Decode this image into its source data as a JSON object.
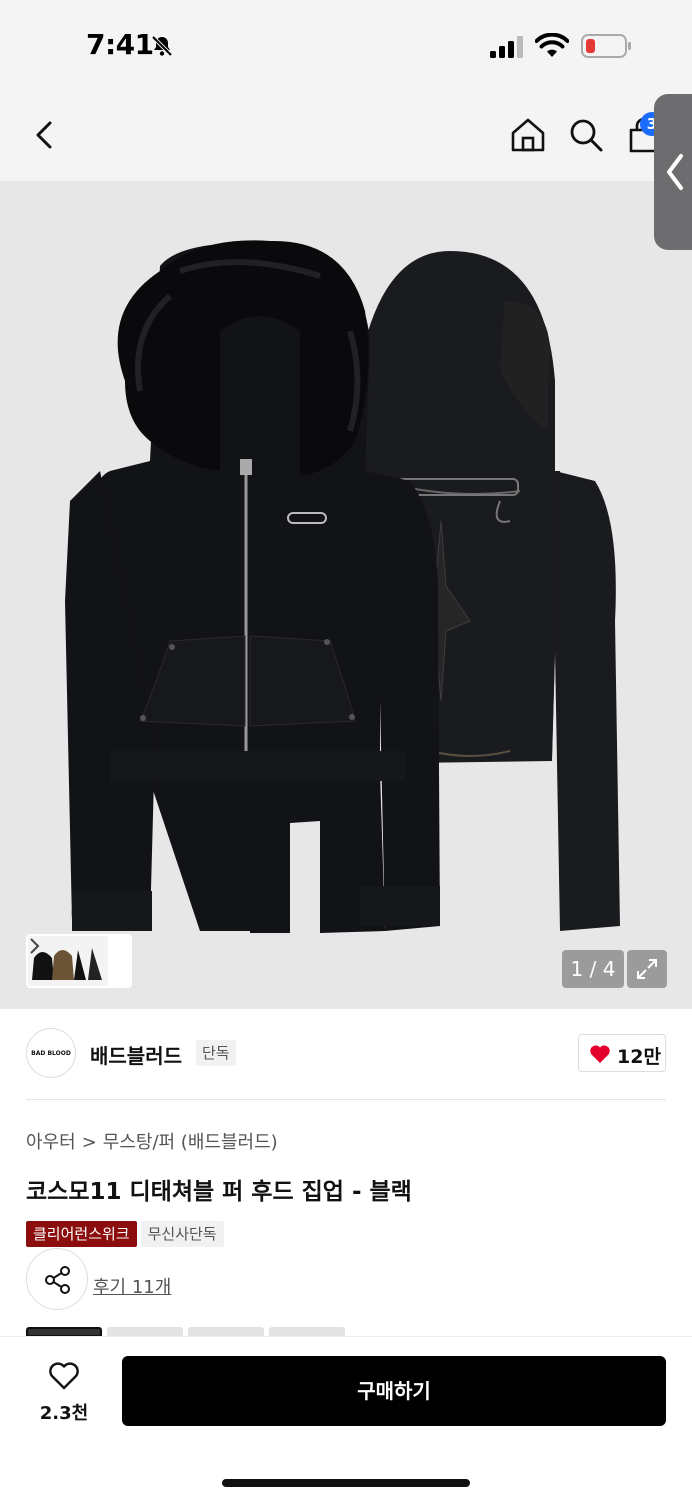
{
  "status_bar": {
    "time": "7:41"
  },
  "nav": {
    "cart_badge": "3"
  },
  "hero": {
    "page_counter": "1 / 4"
  },
  "brand": {
    "logo_text": "BAD BLOOD",
    "name": "배드블러드",
    "badge": "단독",
    "like_count": "12만"
  },
  "product": {
    "breadcrumb": [
      "아우터",
      "무스탕/퍼 (배드블러드)"
    ],
    "breadcrumb_sep": ">",
    "title": "코스모11 디태쳐블 퍼 후드 집업 - 블랙",
    "tags": [
      "클리어런스위크",
      "무신사단독"
    ],
    "review_link": "후기 11개"
  },
  "bottom": {
    "wish_count": "2.3천",
    "buy_label": "구매하기"
  },
  "colors": {
    "accent_red": "#8b0d0d",
    "heart_red": "#e4002b",
    "badge_blue": "#1a6cff"
  },
  "icons": [
    "bell-off-icon",
    "signal-icon",
    "wifi-icon",
    "battery-icon",
    "back-icon",
    "home-icon",
    "search-icon",
    "cart-icon",
    "expand-icon",
    "heart-icon",
    "share-icon",
    "chevron-right-icon"
  ]
}
